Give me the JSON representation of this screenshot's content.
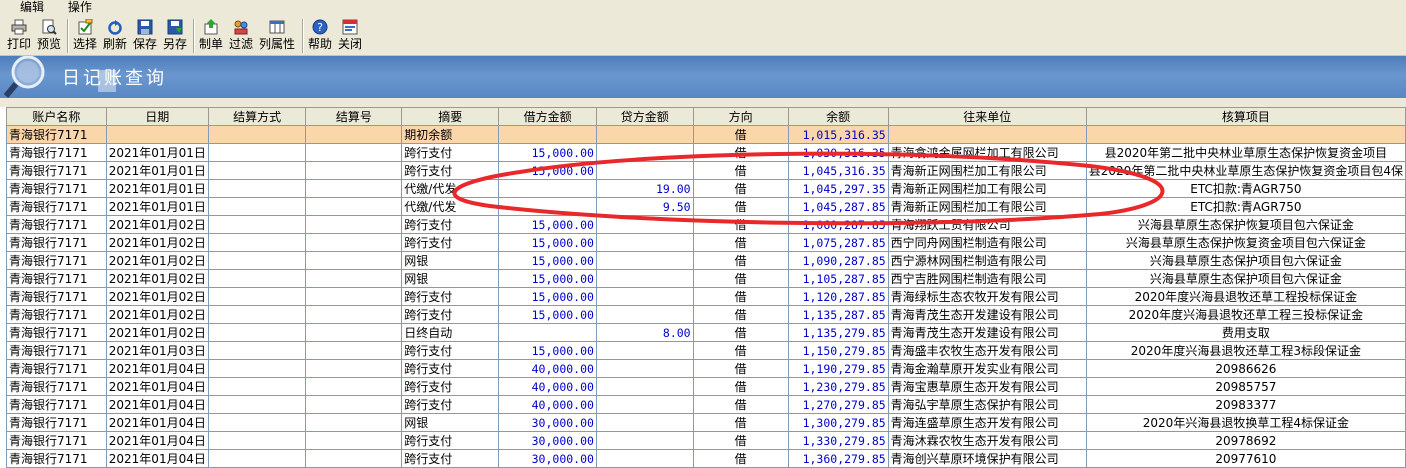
{
  "menu": {
    "items": [
      "编辑",
      "操作"
    ]
  },
  "toolbar": {
    "buttons": [
      {
        "label": "打印",
        "icon": "printer-icon"
      },
      {
        "label": "预览",
        "icon": "preview-icon"
      },
      {
        "label": "选择",
        "icon": "select-icon"
      },
      {
        "label": "刷新",
        "icon": "refresh-icon"
      },
      {
        "label": "保存",
        "icon": "save-icon"
      },
      {
        "label": "另存",
        "icon": "save-as-icon"
      },
      {
        "label": "制单",
        "icon": "voucher-icon"
      },
      {
        "label": "过滤",
        "icon": "filter-icon"
      },
      {
        "label": "列属性",
        "icon": "column-properties-icon"
      },
      {
        "label": "帮助",
        "icon": "help-icon"
      },
      {
        "label": "关闭",
        "icon": "close-icon"
      }
    ]
  },
  "header": {
    "title": "日记账查询"
  },
  "table": {
    "columns": [
      "账户名称",
      "日期",
      "结算方式",
      "结算号",
      "摘要",
      "借方金额",
      "贷方金额",
      "方向",
      "余额",
      "往来单位",
      "核算项目"
    ],
    "rows": [
      [
        "青海银行7171",
        "",
        "",
        "",
        "期初余额",
        "",
        "",
        "借",
        "1,015,316.35",
        "",
        ""
      ],
      [
        "青海银行7171",
        "2021年01月01日",
        "",
        "",
        "跨行支付",
        "15,000.00",
        "",
        "借",
        "1,030,316.35",
        "青海翕鸿金属网栏加工有限公司",
        "县2020年第二批中央林业草原生态保护恢复资金项目"
      ],
      [
        "青海银行7171",
        "2021年01月01日",
        "",
        "",
        "跨行支付",
        "15,000.00",
        "",
        "借",
        "1,045,316.35",
        "青海新正网围栏加工有限公司",
        "县2020年第二批中央林业草原生态保护恢复资金项目包4保"
      ],
      [
        "青海银行7171",
        "2021年01月01日",
        "",
        "",
        "代缴/代发",
        "",
        "19.00",
        "借",
        "1,045,297.35",
        "青海新正网围栏加工有限公司",
        "ETC扣款:青AGR750"
      ],
      [
        "青海银行7171",
        "2021年01月01日",
        "",
        "",
        "代缴/代发",
        "",
        "9.50",
        "借",
        "1,045,287.85",
        "青海新正网围栏加工有限公司",
        "ETC扣款:青AGR750"
      ],
      [
        "青海银行7171",
        "2021年01月02日",
        "",
        "",
        "跨行支付",
        "15,000.00",
        "",
        "借",
        "1,060,287.85",
        "青海翔跃工贸有限公司",
        "兴海县草原生态保护恢复项目包六保证金"
      ],
      [
        "青海银行7171",
        "2021年01月02日",
        "",
        "",
        "跨行支付",
        "15,000.00",
        "",
        "借",
        "1,075,287.85",
        "西宁同舟网围栏制造有限公司",
        "兴海县草原生态保护恢复资金项目包六保证金"
      ],
      [
        "青海银行7171",
        "2021年01月02日",
        "",
        "",
        "网银",
        "15,000.00",
        "",
        "借",
        "1,090,287.85",
        "西宁源林网围栏制造有限公司",
        "兴海县草原生态保护项目包六保证金"
      ],
      [
        "青海银行7171",
        "2021年01月02日",
        "",
        "",
        "网银",
        "15,000.00",
        "",
        "借",
        "1,105,287.85",
        "西宁吉胜网围栏制造有限公司",
        "兴海县草原生态保护项目包六保证金"
      ],
      [
        "青海银行7171",
        "2021年01月02日",
        "",
        "",
        "跨行支付",
        "15,000.00",
        "",
        "借",
        "1,120,287.85",
        "青海绿标生态农牧开发有限公司",
        "2020年度兴海县退牧还草工程投标保证金"
      ],
      [
        "青海银行7171",
        "2021年01月02日",
        "",
        "",
        "跨行支付",
        "15,000.00",
        "",
        "借",
        "1,135,287.85",
        "青海青茂生态开发建设有限公司",
        "2020年度兴海县退牧还草工程三投标保证金"
      ],
      [
        "青海银行7171",
        "2021年01月02日",
        "",
        "",
        "日终自动",
        "",
        "8.00",
        "借",
        "1,135,279.85",
        "青海青茂生态开发建设有限公司",
        "费用支取"
      ],
      [
        "青海银行7171",
        "2021年01月03日",
        "",
        "",
        "跨行支付",
        "15,000.00",
        "",
        "借",
        "1,150,279.85",
        "青海盛丰农牧生态开发有限公司",
        "2020年度兴海县退牧还草工程3标段保证金"
      ],
      [
        "青海银行7171",
        "2021年01月04日",
        "",
        "",
        "跨行支付",
        "40,000.00",
        "",
        "借",
        "1,190,279.85",
        "青海金瀚草原开发实业有限公司",
        "20986626"
      ],
      [
        "青海银行7171",
        "2021年01月04日",
        "",
        "",
        "跨行支付",
        "40,000.00",
        "",
        "借",
        "1,230,279.85",
        "青海宝惠草原生态开发有限公司",
        "20985757"
      ],
      [
        "青海银行7171",
        "2021年01月04日",
        "",
        "",
        "跨行支付",
        "40,000.00",
        "",
        "借",
        "1,270,279.85",
        "青海弘宇草原生态保护有限公司",
        "20983377"
      ],
      [
        "青海银行7171",
        "2021年01月04日",
        "",
        "",
        "网银",
        "30,000.00",
        "",
        "借",
        "1,300,279.85",
        "青海连盛草原生态开发有限公司",
        "2020年兴海县退牧换草工程4标保证金"
      ],
      [
        "青海银行7171",
        "2021年01月04日",
        "",
        "",
        "跨行支付",
        "30,000.00",
        "",
        "借",
        "1,330,279.85",
        "青海沐霖农牧生态开发有限公司",
        "20978692"
      ],
      [
        "青海银行7171",
        "2021年01月04日",
        "",
        "",
        "跨行支付",
        "30,000.00",
        "",
        "借",
        "1,360,279.85",
        "青海创兴草原环境保护有限公司",
        "20977610"
      ]
    ]
  },
  "annotation": {
    "color": "#e8282a"
  }
}
